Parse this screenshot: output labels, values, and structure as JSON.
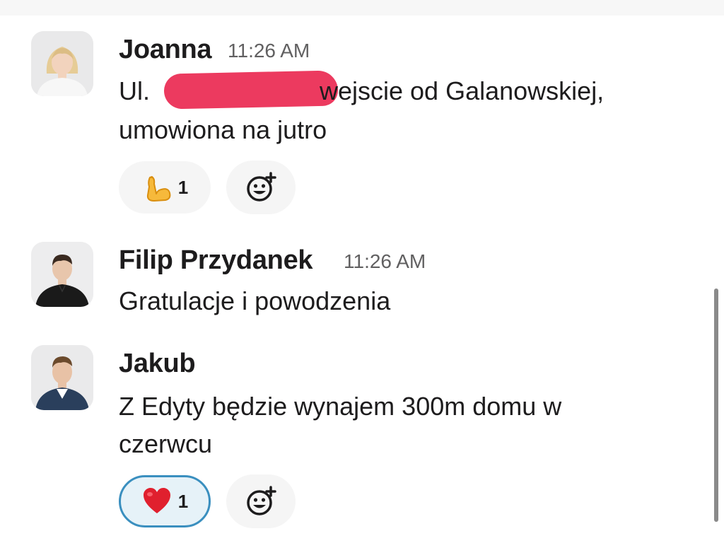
{
  "messages": [
    {
      "author": "Joanna",
      "time": "11:26 AM",
      "lines": [
        "Ul. ",
        "wejscie od Galanowskiej,",
        "umowiona na jutro"
      ],
      "reaction": {
        "emoji": "flexed-biceps",
        "count": "1"
      }
    },
    {
      "author": "Filip Przydanek",
      "time": "11:26 AM",
      "lines": [
        "Gratulacje i powodzenia"
      ]
    },
    {
      "author": "Jakub",
      "lines": [
        "Z Edyty będzie wynajem 300m domu w",
        "czerwcu"
      ],
      "reaction": {
        "emoji": "red-heart",
        "count": "1"
      }
    }
  ],
  "colors": {
    "redaction": "#ec3a5f",
    "reaction_active_border": "#3a8fbf",
    "reaction_active_bg": "#e6f2f8",
    "timestamp": "#616061"
  },
  "icons": {
    "add_reaction": "add-reaction-icon"
  }
}
